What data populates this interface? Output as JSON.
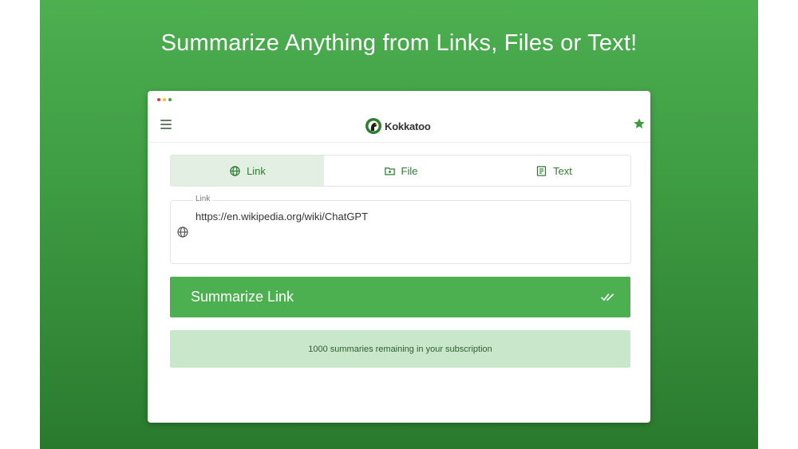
{
  "headline": "Summarize Anything from Links, Files or Text!",
  "window": {
    "traffic_colors": [
      "#e53935",
      "#fbc02d",
      "#43a047"
    ]
  },
  "header": {
    "menu_icon": "menu-icon",
    "logo_text": "Kokkatoo",
    "star_icon": "star-icon"
  },
  "tabs": [
    {
      "label": "Link",
      "icon": "globe-icon",
      "active": true
    },
    {
      "label": "File",
      "icon": "folder-plus-icon",
      "active": false
    },
    {
      "label": "Text",
      "icon": "document-icon",
      "active": false
    }
  ],
  "link_field": {
    "label": "Link",
    "value": "https://en.wikipedia.org/wiki/ChatGPT",
    "icon": "globe-icon"
  },
  "summarize_button": {
    "label": "Summarize Link",
    "icon": "double-check-icon"
  },
  "status": {
    "text": "1000 summaries remaining in your subscription"
  },
  "colors": {
    "accent": "#4caf50",
    "accent_dark": "#2e7d32",
    "status_bg": "#c9e7ca",
    "tab_active_bg": "#e3efe3"
  }
}
